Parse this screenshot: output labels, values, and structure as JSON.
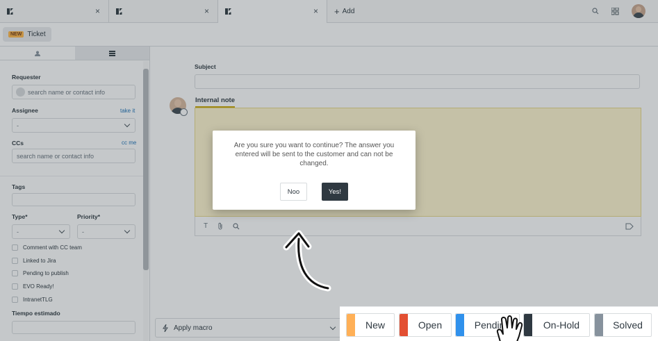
{
  "tabs": {
    "items": [
      {
        "close": "×"
      },
      {
        "close": "×"
      },
      {
        "close": "×"
      }
    ],
    "add_label": "Add",
    "add_symbol": "+"
  },
  "header": {
    "ticket_badge": "NEW",
    "ticket_label": "Ticket"
  },
  "sidebar": {
    "requester_label": "Requester",
    "requester_placeholder": "search name or contact info",
    "assignee_label": "Assignee",
    "take_it": "take it",
    "assignee_value": "-",
    "ccs_label": "CCs",
    "cc_me": "cc me",
    "ccs_placeholder": "search name or contact info",
    "tags_label": "Tags",
    "type_label": "Type*",
    "type_value": "-",
    "priority_label": "Priority*",
    "priority_value": "-",
    "checkboxes": [
      "Comment with CC team",
      "Linked to Jira",
      "Pending to publish",
      "EVO Ready!",
      "IntranetTLG"
    ],
    "tiempo_label": "Tiempo estimado"
  },
  "main": {
    "subject_label": "Subject",
    "note_tab": "Internal note",
    "apply_macro": "Apply macro"
  },
  "dialog": {
    "message": "Are you sure you want to continue? The answer you entered will be sent to the customer and can not be changed.",
    "no_label": "Noo",
    "yes_label": "Yes!"
  },
  "status_buttons": [
    {
      "label": "New",
      "color": "#ffb057"
    },
    {
      "label": "Open",
      "color": "#e34f32"
    },
    {
      "label": "Pending",
      "color": "#3091ec"
    },
    {
      "label": "On-Hold",
      "color": "#2f3941"
    },
    {
      "label": "Solved",
      "color": "#87929d"
    }
  ],
  "colors": {
    "accent_dark": "#2f3941",
    "link": "#1f73b7",
    "note_bg": "#fff6cf"
  }
}
